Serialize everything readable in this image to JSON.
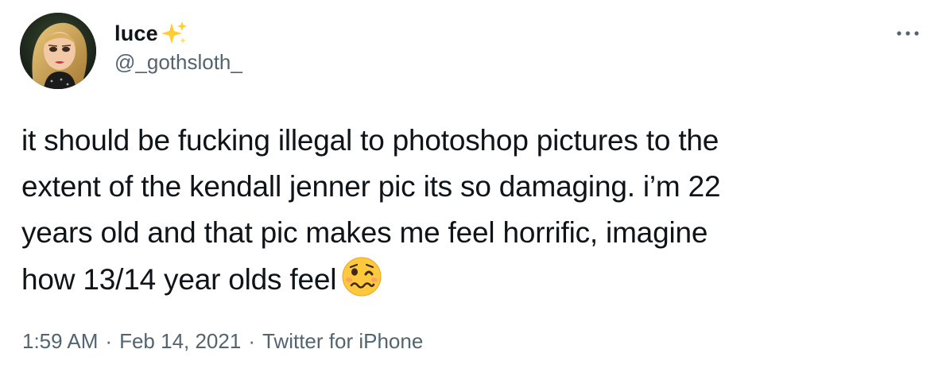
{
  "author": {
    "display_name": "luce",
    "name_emoji": "sparkles-icon",
    "handle": "@_gothsloth_",
    "avatar": "avatar"
  },
  "tweet": {
    "text_lines": [
      "it should be fucking illegal to photoshop pictures to the",
      "extent of the kendall jenner pic its so damaging. i’m 22",
      "years old and that pic makes me feel horrific, imagine",
      "how 13/14 year olds feel"
    ],
    "trailing_emoji": "woozy-face-icon"
  },
  "meta": {
    "time": "1:59 AM",
    "separator": "·",
    "date": "Feb 14, 2021",
    "source": "Twitter for iPhone"
  },
  "menu": {
    "icon": "more-dots-icon"
  },
  "colors": {
    "text": "#0f1419",
    "secondary": "#536471",
    "background": "#ffffff",
    "sparkle": "#ffcc33",
    "emoji_face": "#ffc83d"
  }
}
